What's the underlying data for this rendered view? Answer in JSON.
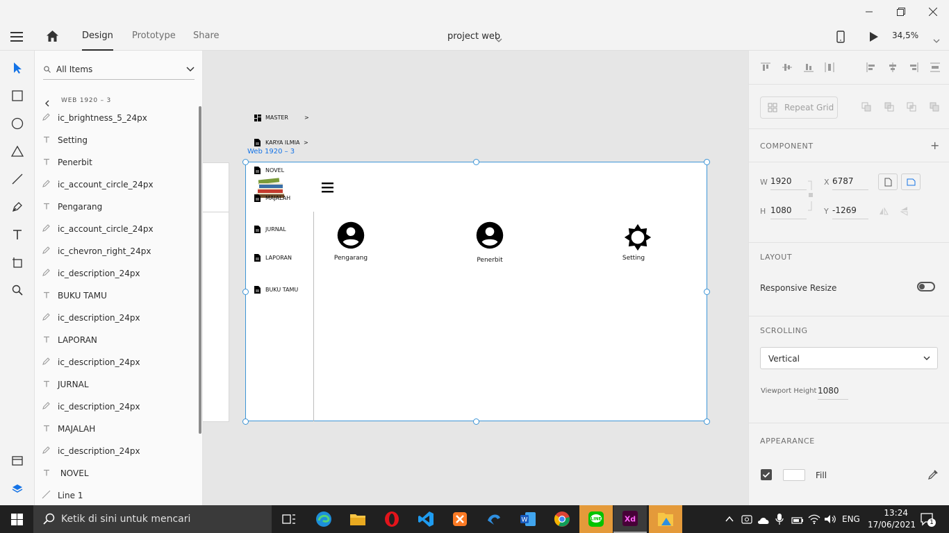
{
  "toolbar": {
    "tabs": [
      "Design",
      "Prototype",
      "Share"
    ],
    "document_title": "project web",
    "zoom": "34,5%"
  },
  "layers": {
    "search_placeholder": "All Items",
    "breadcrumb": "WEB 1920 – 3",
    "items": [
      {
        "type": "path",
        "name": "ic_brightness_5_24px"
      },
      {
        "type": "text",
        "name": "Setting"
      },
      {
        "type": "text",
        "name": "Penerbit"
      },
      {
        "type": "path",
        "name": "ic_account_circle_24px"
      },
      {
        "type": "text",
        "name": "Pengarang"
      },
      {
        "type": "path",
        "name": "ic_account_circle_24px"
      },
      {
        "type": "path",
        "name": "ic_chevron_right_24px"
      },
      {
        "type": "path",
        "name": "ic_description_24px"
      },
      {
        "type": "text",
        "name": "BUKU TAMU"
      },
      {
        "type": "path",
        "name": "ic_description_24px"
      },
      {
        "type": "text",
        "name": "LAPORAN"
      },
      {
        "type": "path",
        "name": "ic_description_24px"
      },
      {
        "type": "text",
        "name": "JURNAL"
      },
      {
        "type": "path",
        "name": "ic_description_24px"
      },
      {
        "type": "text",
        "name": "MAJALAH"
      },
      {
        "type": "path",
        "name": "ic_description_24px"
      },
      {
        "type": "text",
        "name": " NOVEL"
      },
      {
        "type": "line",
        "name": "Line 1"
      }
    ]
  },
  "artboard": {
    "label": "Web 1920 – 3",
    "menu": [
      {
        "label": "MASTER",
        "suffix": ">"
      },
      {
        "label": "KARYA ILMIA",
        "suffix": ">"
      },
      {
        "label": "NOVEL",
        "suffix": ""
      },
      {
        "label": "MAJALAH",
        "suffix": ""
      },
      {
        "label": "JURNAL",
        "suffix": ""
      },
      {
        "label": "LAPORAN",
        "suffix": ""
      },
      {
        "label": "BUKU TAMU",
        "suffix": ""
      }
    ],
    "cards": [
      {
        "label": "Pengarang",
        "icon": "account-circle-icon"
      },
      {
        "label": "Penerbit",
        "icon": "account-circle-icon"
      },
      {
        "label": "Setting",
        "icon": "brightness-icon"
      }
    ]
  },
  "properties": {
    "repeat_grid": "Repeat Grid",
    "component_title": "COMPONENT",
    "w_label": "W",
    "w": "1920",
    "x_label": "X",
    "x": "6787",
    "h_label": "H",
    "h": "1080",
    "y_label": "Y",
    "y": "-1269",
    "layout_title": "LAYOUT",
    "responsive_resize": "Responsive Resize",
    "scrolling_title": "SCROLLING",
    "scrolling_value": "Vertical",
    "viewport_height_label": "Viewport Height",
    "viewport_height": "1080",
    "appearance_title": "APPEARANCE",
    "fill_label": "Fill",
    "fill_color": "#ffffff"
  },
  "taskbar": {
    "search_placeholder": "Ketik di sini untuk mencari",
    "language": "ENG",
    "time": "13:24",
    "date": "17/06/2021",
    "notification_count": "1"
  },
  "colors": {
    "accent": "#1473e6",
    "xd_pink": "#ff61f6",
    "xd_bg": "#470137",
    "selection": "#3d95d6"
  }
}
